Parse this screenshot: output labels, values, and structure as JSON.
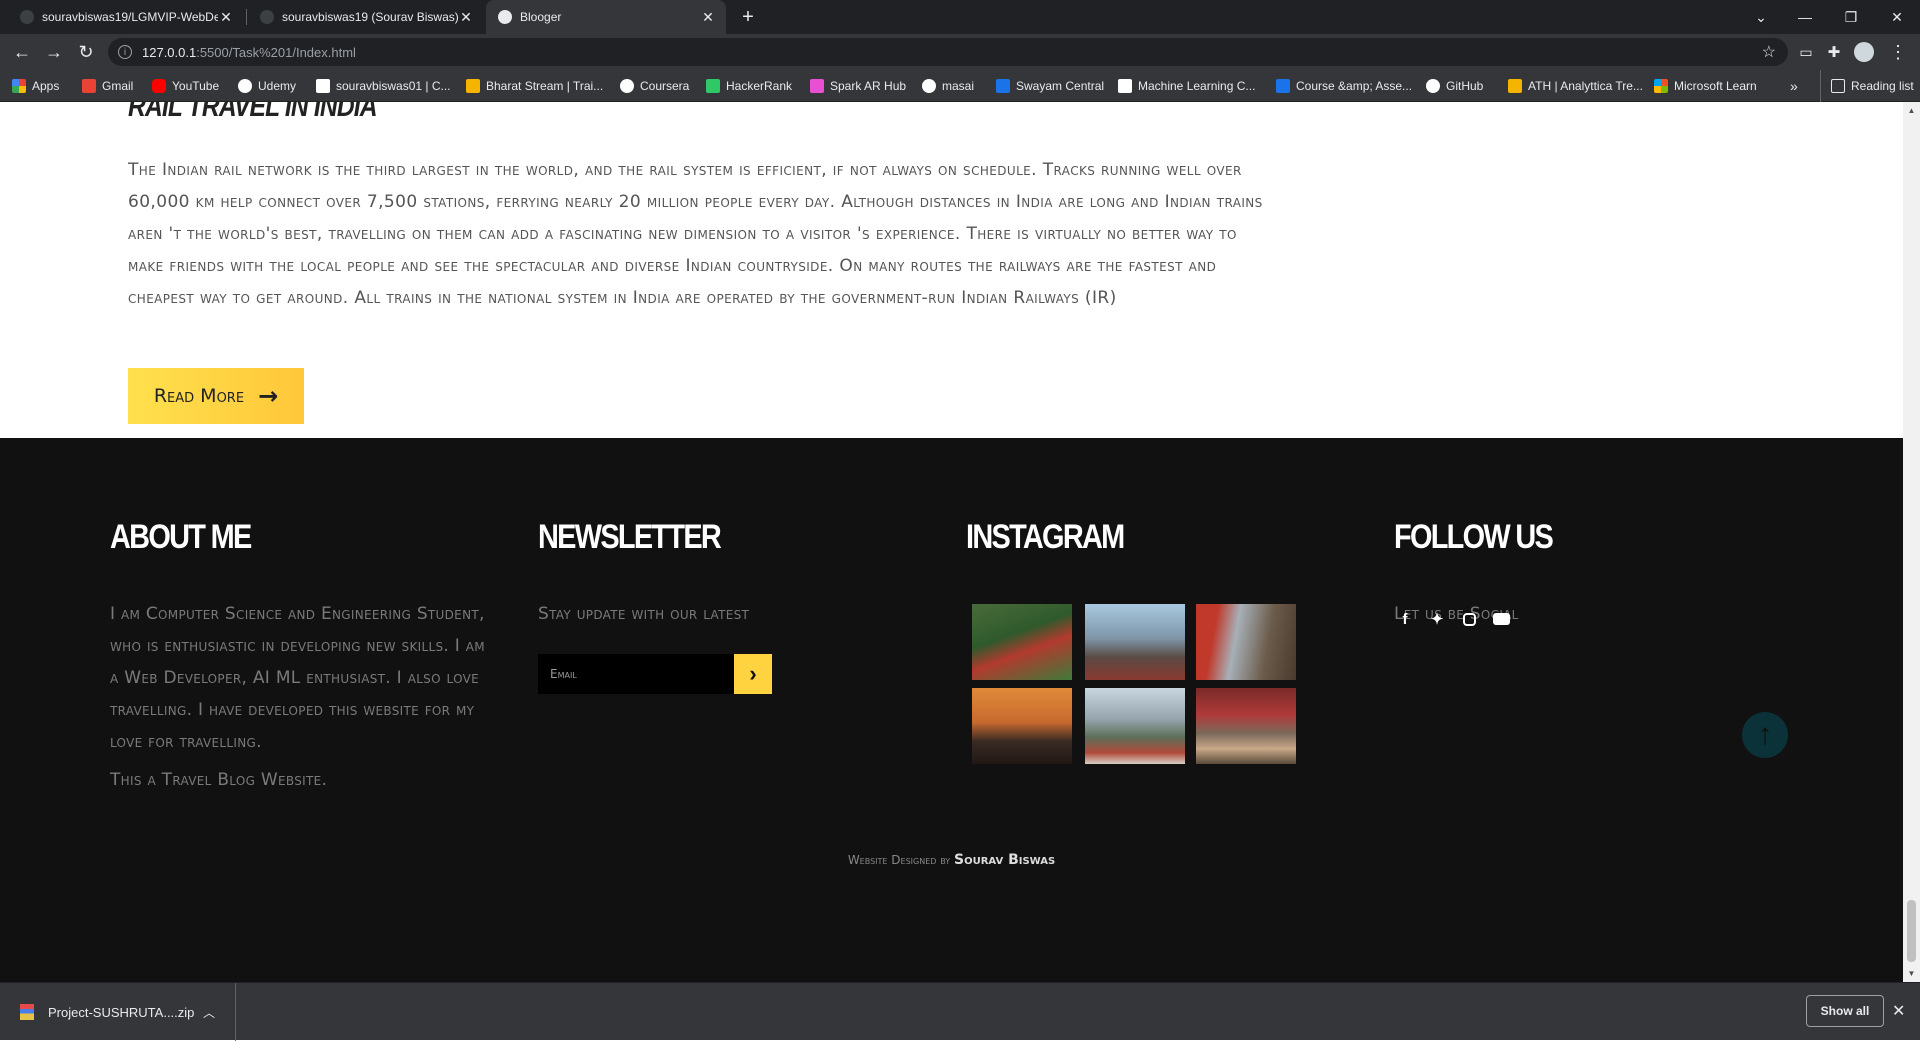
{
  "browser": {
    "tabs": [
      {
        "title": "souravbiswas19/LGMVIP-WebDe",
        "active": false
      },
      {
        "title": "souravbiswas19 (Sourav Biswas)",
        "active": false
      },
      {
        "title": "Blooger",
        "active": true
      }
    ],
    "new_tab": "+",
    "address": {
      "host": "127.0.0.1",
      "path": ":5500/Task%201/Index.html"
    },
    "bookmarks": [
      {
        "label": "Apps",
        "color": "#ea4335"
      },
      {
        "label": "Gmail",
        "color": "#ea4335"
      },
      {
        "label": "YouTube",
        "color": "#ff0000"
      },
      {
        "label": "Udemy",
        "color": "#ffffff"
      },
      {
        "label": "souravbiswas01 | C...",
        "color": "#ffffff"
      },
      {
        "label": "Bharat Stream | Trai...",
        "color": "#f4b400"
      },
      {
        "label": "Coursera",
        "color": "#1a73e8"
      },
      {
        "label": "HackerRank",
        "color": "#2ec866"
      },
      {
        "label": "Spark AR Hub",
        "color": "#e94fd1"
      },
      {
        "label": "masai",
        "color": "#ffffff"
      },
      {
        "label": "Swayam Central",
        "color": "#1a73e8"
      },
      {
        "label": "Machine Learning C...",
        "color": "#ffffff"
      },
      {
        "label": "Course &amp; Asse...",
        "color": "#1a73e8"
      },
      {
        "label": "GitHub",
        "color": "#ffffff"
      },
      {
        "label": "ATH | Analyttica Tre...",
        "color": "#f4b400"
      },
      {
        "label": "Microsoft Learn",
        "color": "#f25022"
      }
    ],
    "bookmarks_overflow": "»",
    "reading_list": "Reading list"
  },
  "article": {
    "title": "Rail Travel in India",
    "body": "The Indian rail network is the third largest in the world, and the rail system is efficient, if not always on schedule. Tracks running well over 60,000 km help connect over 7,500 stations, ferrying nearly 20 million people every day. Although distances in India are long and Indian trains aren 't the world's best, travelling on them can add a fascinating new dimension to a visitor 's experience. There is virtually no better way to make friends with the local people and see the spectacular and diverse Indian countryside. On many routes the railways are the fastest and cheapest way to get around. All trains in the national system in India are operated by the government-run Indian Railways (IR)",
    "read_more": "Read More"
  },
  "footer": {
    "about": {
      "title": "About Me",
      "text": "I am Computer Science and Engineering Student, who is enthusiastic in developing new skills. I am a Web Developer, AI ML enthusiast. I also love travelling. I have developed this website for my love for travelling.",
      "tagline": "This a Travel Blog Website."
    },
    "newsletter": {
      "title": "Newsletter",
      "text": "Stay update with our latest",
      "email_placeholder": "Email"
    },
    "instagram": {
      "title": "Instagram"
    },
    "follow": {
      "title": "Follow Us",
      "text": "Let us be Social",
      "icons": [
        "facebook-icon",
        "twitter-icon",
        "instagram-icon",
        "youtube-icon"
      ]
    },
    "credits": {
      "prefix": "Website Designed by",
      "author": "Sourav Biswas"
    }
  },
  "downloads": {
    "file": "Project-SUSHRUTA....zip",
    "show_all": "Show all"
  },
  "colors": {
    "accent": "#ffd23f",
    "footer_bg": "#111111",
    "to_top": "#0b3238"
  }
}
